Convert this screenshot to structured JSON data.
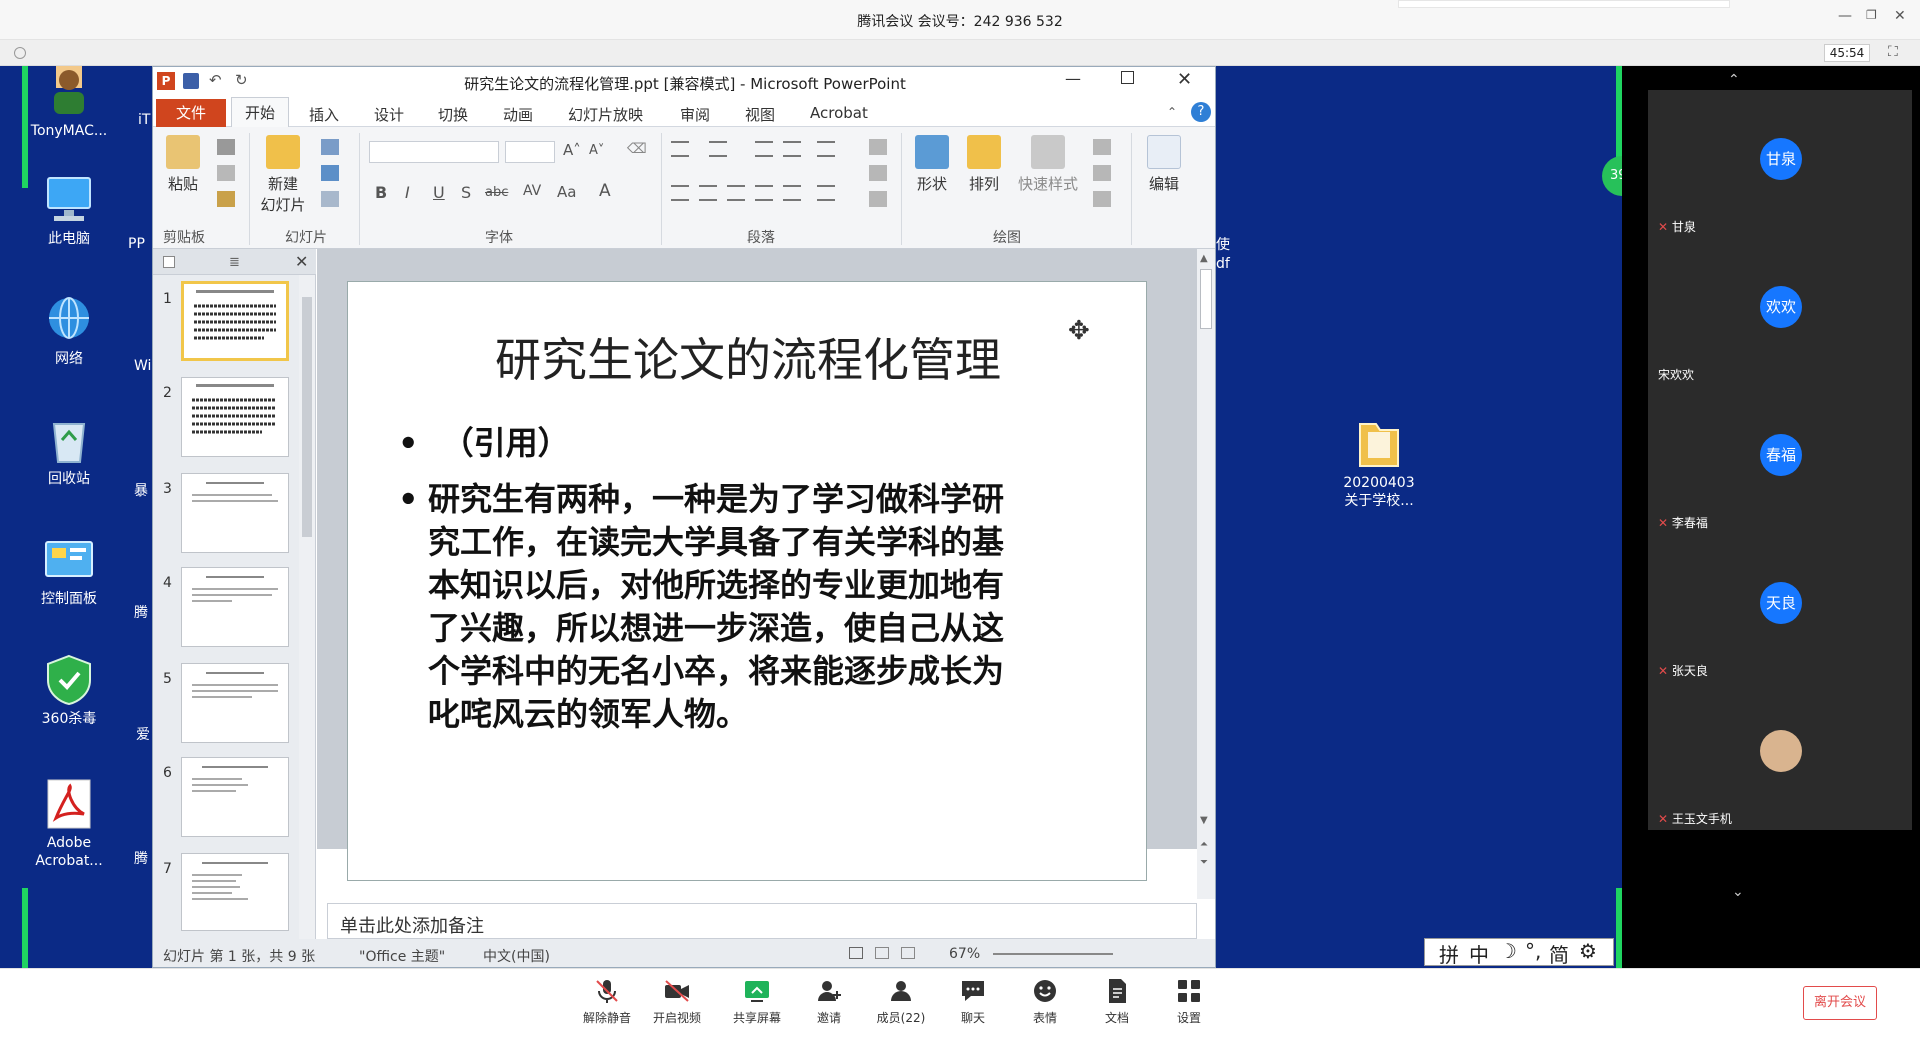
{
  "meeting": {
    "title": "腾讯会议 会议号：242 936 532",
    "timer": "45:54"
  },
  "desktop": {
    "icons": [
      {
        "label": "TonyMAC...",
        "icon": "user-folder-icon"
      },
      {
        "label": "此电脑",
        "icon": "computer-icon"
      },
      {
        "label": "网络",
        "icon": "network-icon"
      },
      {
        "label": "回收站",
        "icon": "recycle-bin-icon"
      },
      {
        "label": "控制面板",
        "icon": "control-panel-icon"
      },
      {
        "label": "360杀毒",
        "icon": "shield-icon"
      },
      {
        "label": "Adobe Acrobat...",
        "icon": "acrobat-icon"
      }
    ],
    "partial_col_labels": [
      "iT",
      "PP",
      "Wi",
      "暴",
      "腾",
      "爱",
      "腾"
    ],
    "folder_label_1": "20200403",
    "folder_label_2": "关于学校...",
    "partial_text_1": "使",
    "partial_text_2": "df",
    "badge_partial": "39"
  },
  "ppt": {
    "window_title": "研究生论文的流程化管理.ppt [兼容模式] - Microsoft PowerPoint",
    "tabs": [
      "文件",
      "开始",
      "插入",
      "设计",
      "切换",
      "动画",
      "幻灯片放映",
      "审阅",
      "视图",
      "Acrobat"
    ],
    "ribbon": {
      "paste": "粘贴",
      "new_slide_1": "新建",
      "new_slide_2": "幻灯片",
      "shape": "形状",
      "arrange": "排列",
      "quick_style": "快速样式",
      "edit": "编辑",
      "groups": [
        "剪贴板",
        "幻灯片",
        "字体",
        "段落",
        "绘图"
      ],
      "font_buttons": [
        "B",
        "I",
        "U",
        "S",
        "abc",
        "AV",
        "Aa",
        "A"
      ]
    },
    "slide_numbers": [
      "1",
      "2",
      "3",
      "4",
      "5",
      "6",
      "7"
    ],
    "slide": {
      "title": "研究生论文的流程化管理",
      "bullet_marker": "•",
      "bullet1": "（引用）",
      "bullet2_lines": [
        "研究生有两种，一种是为了学习做科学研",
        "究工作，在读完大学具备了有关学科的基",
        "本知识以后，对他所选择的专业更加地有",
        "了兴趣，所以想进一步深造，使自己从这",
        "个学科中的无名小卒，将来能逐步成长为",
        "叱咤风云的领军人物。"
      ]
    },
    "notes_placeholder": "单击此处添加备注",
    "status": {
      "slide_info": "幻灯片 第 1 张，共 9 张",
      "theme": "\"Office 主题\"",
      "language": "中文(中国)",
      "zoom": "67%"
    }
  },
  "participants": [
    {
      "avatar_text": "甘泉",
      "name": "甘泉",
      "muted": true
    },
    {
      "avatar_text": "欢欢",
      "name": "宋欢欢",
      "muted": false
    },
    {
      "avatar_text": "春福",
      "name": "李春福",
      "muted": true
    },
    {
      "avatar_text": "天良",
      "name": "张天良",
      "muted": true
    },
    {
      "avatar_text": "",
      "name": "王玉文手机",
      "muted": true
    }
  ],
  "toolbar": {
    "buttons": [
      {
        "label": "解除静音",
        "icon": "mic-muted-icon"
      },
      {
        "label": "开启视频",
        "icon": "camera-off-icon"
      },
      {
        "label": "共享屏幕",
        "icon": "share-screen-icon"
      },
      {
        "label": "邀请",
        "icon": "invite-icon"
      },
      {
        "label": "成员(22)",
        "icon": "members-icon"
      },
      {
        "label": "聊天",
        "icon": "chat-icon"
      },
      {
        "label": "表情",
        "icon": "emoji-icon"
      },
      {
        "label": "文档",
        "icon": "document-icon"
      },
      {
        "label": "设置",
        "icon": "settings-icon"
      }
    ],
    "leave": "离开会议"
  },
  "ime": {
    "items": [
      "拼",
      "中",
      "☽",
      "°,",
      "简",
      "⚙"
    ]
  },
  "colors": {
    "desktop_bg": "#0b2a86",
    "accent_blue": "#1677ff",
    "ppt_file_tab": "#d0451e",
    "share_border": "#1fd461",
    "leave_red": "#e24b4b"
  }
}
